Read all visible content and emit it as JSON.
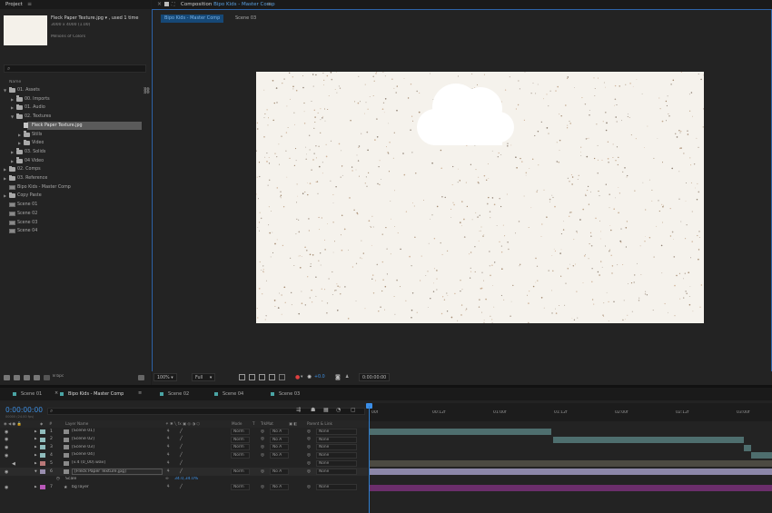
{
  "project": {
    "tab_label": "Project",
    "menu_glyph": "≡",
    "selected_name": "Fleck Paper Texture.jpg ▾ , used 1 time",
    "selected_dims": "3000 x 4000 (1.00)",
    "selected_colors": "Millions of Colors",
    "search_icon": "search-icon",
    "name_header": "Name",
    "tree": [
      {
        "label": "01. Assets",
        "kind": "folder",
        "indent": 0,
        "arrow": "▼"
      },
      {
        "label": "00. Imports",
        "kind": "folder",
        "indent": 1,
        "arrow": "▶"
      },
      {
        "label": "01. Audio",
        "kind": "folder",
        "indent": 1,
        "arrow": "▶"
      },
      {
        "label": "02. Textures",
        "kind": "folder",
        "indent": 1,
        "arrow": "▼"
      },
      {
        "label": "Fleck Paper Texture.jpg",
        "kind": "file",
        "indent": 2,
        "arrow": ""
      },
      {
        "label": "Stills",
        "kind": "folder",
        "indent": 2,
        "arrow": "▶"
      },
      {
        "label": "Video",
        "kind": "folder",
        "indent": 2,
        "arrow": "▶"
      },
      {
        "label": "03. Solids",
        "kind": "folder",
        "indent": 1,
        "arrow": "▶"
      },
      {
        "label": "04 Video",
        "kind": "folder",
        "indent": 1,
        "arrow": "▶"
      },
      {
        "label": "02. Comps",
        "kind": "folder",
        "indent": 0,
        "arrow": "▶"
      },
      {
        "label": "03. Reference",
        "kind": "folder",
        "indent": 0,
        "arrow": "▶"
      },
      {
        "label": "Bipo Kids - Master Comp",
        "kind": "comp",
        "indent": 0,
        "arrow": ""
      },
      {
        "label": "Copy Paste",
        "kind": "folder",
        "indent": 0,
        "arrow": "▶"
      },
      {
        "label": "Scene 01",
        "kind": "comp",
        "indent": 0,
        "arrow": ""
      },
      {
        "label": "Scene 02",
        "kind": "comp",
        "indent": 0,
        "arrow": ""
      },
      {
        "label": "Scene 03",
        "kind": "comp",
        "indent": 0,
        "arrow": ""
      },
      {
        "label": "Scene 04",
        "kind": "comp",
        "indent": 0,
        "arrow": ""
      }
    ],
    "bpc": "8 bpc"
  },
  "composition": {
    "panel_prefix": "Composition",
    "comp_name": "Bipo Kids - Master Comp",
    "flow_active": "Bipo Kids - Master Comp",
    "flow_next": "Scene 03",
    "zoom": "100%",
    "resolution": "Full",
    "exposure": "+0.0",
    "timecode": "0:00:00:00"
  },
  "timeline": {
    "tabs": [
      {
        "label": "Scene 01",
        "color": "#4aa4a4",
        "active": false
      },
      {
        "label": "Bipo Kids - Master Comp",
        "color": "#4aa4a4",
        "active": true
      },
      {
        "label": "Scene 02",
        "color": "#4aa4a4",
        "active": false
      },
      {
        "label": "Scene 04",
        "color": "#4aa4a4",
        "active": false
      },
      {
        "label": "Scene 03",
        "color": "#4aa4a4",
        "active": false
      }
    ],
    "timecode": "0:00:00:00",
    "timecode_sub": "00000 (24.00 fps)",
    "ruler_ticks": [
      "00f",
      "00:12f",
      "01:00f",
      "01:12f",
      "02:00f",
      "02:12f",
      "03:00f"
    ],
    "columns": {
      "layer_name": "Layer Name",
      "mode": "Mode",
      "t": "T",
      "trkmat": "TrkMat",
      "parent": "Parent & Link"
    },
    "layers": [
      {
        "num": "1",
        "name": "[Scene 01]",
        "color": "#8fbcbc",
        "mode": "Norm",
        "trkmat": "No A",
        "parent": "None",
        "bar_color": "#4e6e6e"
      },
      {
        "num": "2",
        "name": "[Scene 02]",
        "color": "#8fbcbc",
        "mode": "Norm",
        "trkmat": "No A",
        "parent": "None",
        "bar_color": "#4e6e6e"
      },
      {
        "num": "3",
        "name": "[Scene 03]",
        "color": "#8fbcbc",
        "mode": "Norm",
        "trkmat": "No A",
        "parent": "None",
        "bar_color": "#4e6e6e"
      },
      {
        "num": "4",
        "name": "[Scene 04]",
        "color": "#8fbcbc",
        "mode": "Norm",
        "trkmat": "No A",
        "parent": "None",
        "bar_color": "#4e6e6e"
      },
      {
        "num": "5",
        "name": "[v.4 (0_00).wav]",
        "color": "#b97878",
        "mode": "",
        "trkmat": "",
        "parent": "None",
        "bar_color": "#4c4a42"
      },
      {
        "num": "6",
        "name": "[Fleck Paper Texture.jpg]",
        "color": "#9a8fb0",
        "mode": "Norm",
        "trkmat": "No A",
        "parent": "None",
        "bar_color": "#8c87a8"
      },
      {
        "num": "",
        "name": "Scale",
        "color": "",
        "mode": "",
        "trkmat": "",
        "parent": "",
        "bar_color": "",
        "value": "34.0,34.0%"
      },
      {
        "num": "7",
        "name": "bg layer",
        "color": "#b858b8",
        "mode": "Norm",
        "trkmat": "No A",
        "parent": "None",
        "bar_color": "#6b2e6b"
      }
    ]
  }
}
